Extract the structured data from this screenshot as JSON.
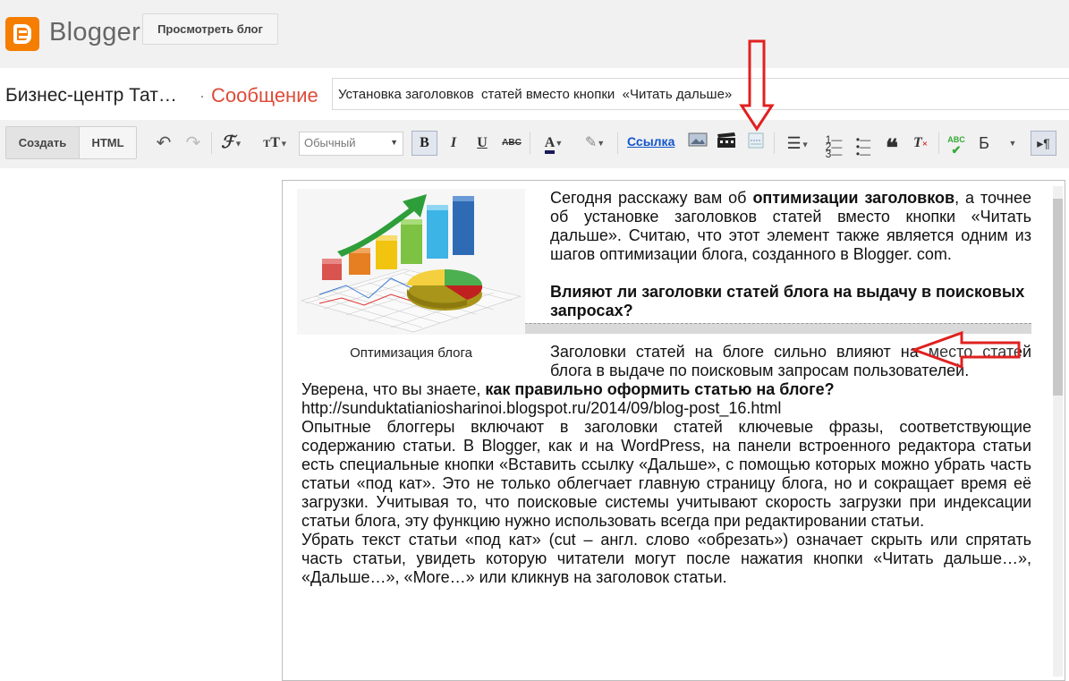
{
  "header": {
    "logo_text": "Blogger",
    "view_blog_label": "Просмотреть блог"
  },
  "post": {
    "blog_name": "Бизнес-центр Тат…",
    "separator": "·",
    "section_label": "Сообщение",
    "title_value": "Установка заголовков  статей вместо кнопки  «Читать дальше»"
  },
  "toolbar": {
    "compose_label": "Создать",
    "html_label": "HTML",
    "style_value": "Обычный",
    "link_label": "Ссылка",
    "lang_label": "Б"
  },
  "body": {
    "image_caption": "Оптимизация блога",
    "intro_1": "Сегодня расскажу вам об ",
    "intro_bold": "оптимизации заголовков",
    "intro_2": ", а точнее об установке заголовков  статей вместо кнопки  «Читать дальше». Считаю, что этот элемент также является одним из шагов оптимизации блога, созданного  в Blogger. com.",
    "heading": "Влияют ли заголовки статей блога на выдачу в поисковых запросах?",
    "p1": "Заголовки статей на блоге сильно  влияют на место статей блога в выдаче по поисковым запросам пользователей.",
    "p2_1": "Уверена, что вы знаете, ",
    "p2_bold": "как правильно оформить статью на блоге?",
    "url": "http://sunduktatianiosharinoi.blogspot.ru/2014/09/blog-post_16.html",
    "p3": "Опытные блоггеры включают  в заголовки статей  ключевые фразы, соответствующие содержанию статьи.  В Blogger, как и на  WordPress,  на панели встроенного редактора статьи есть специальные кнопки  «Вставить ссылку «Дальше», с помощью которых можно убрать часть статьи «под кат». Это  не только облегчает главную страницу  блога, но и сокращает время её загрузки. Учитывая то, что поисковые системы учитывают скорость загрузки при индексации статьи блога, эту функцию нужно использовать всегда при редактировании статьи.",
    "p4": "Убрать текст статьи «под кат»  (cut – англ. слово «обрезать») означает скрыть или спрятать часть статьи, увидеть которую читатели могут после нажатия кнопки  «Читать дальше…», «Дальше…», «More…» или кликнув на заголовок статьи."
  },
  "colors": {
    "accent": "#dd4b39",
    "logo_orange": "#f57d00",
    "arrow_red": "#e02020",
    "link_blue": "#1155cc"
  },
  "icons": [
    "undo-icon",
    "redo-icon",
    "font-icon",
    "font-size-icon",
    "bold-icon",
    "italic-icon",
    "underline-icon",
    "strikethrough-icon",
    "text-color-icon",
    "highlight-icon",
    "image-icon",
    "video-icon",
    "jump-break-icon",
    "align-icon",
    "numbered-list-icon",
    "bullet-list-icon",
    "quote-icon",
    "clear-format-icon",
    "spellcheck-icon",
    "rtl-icon"
  ]
}
